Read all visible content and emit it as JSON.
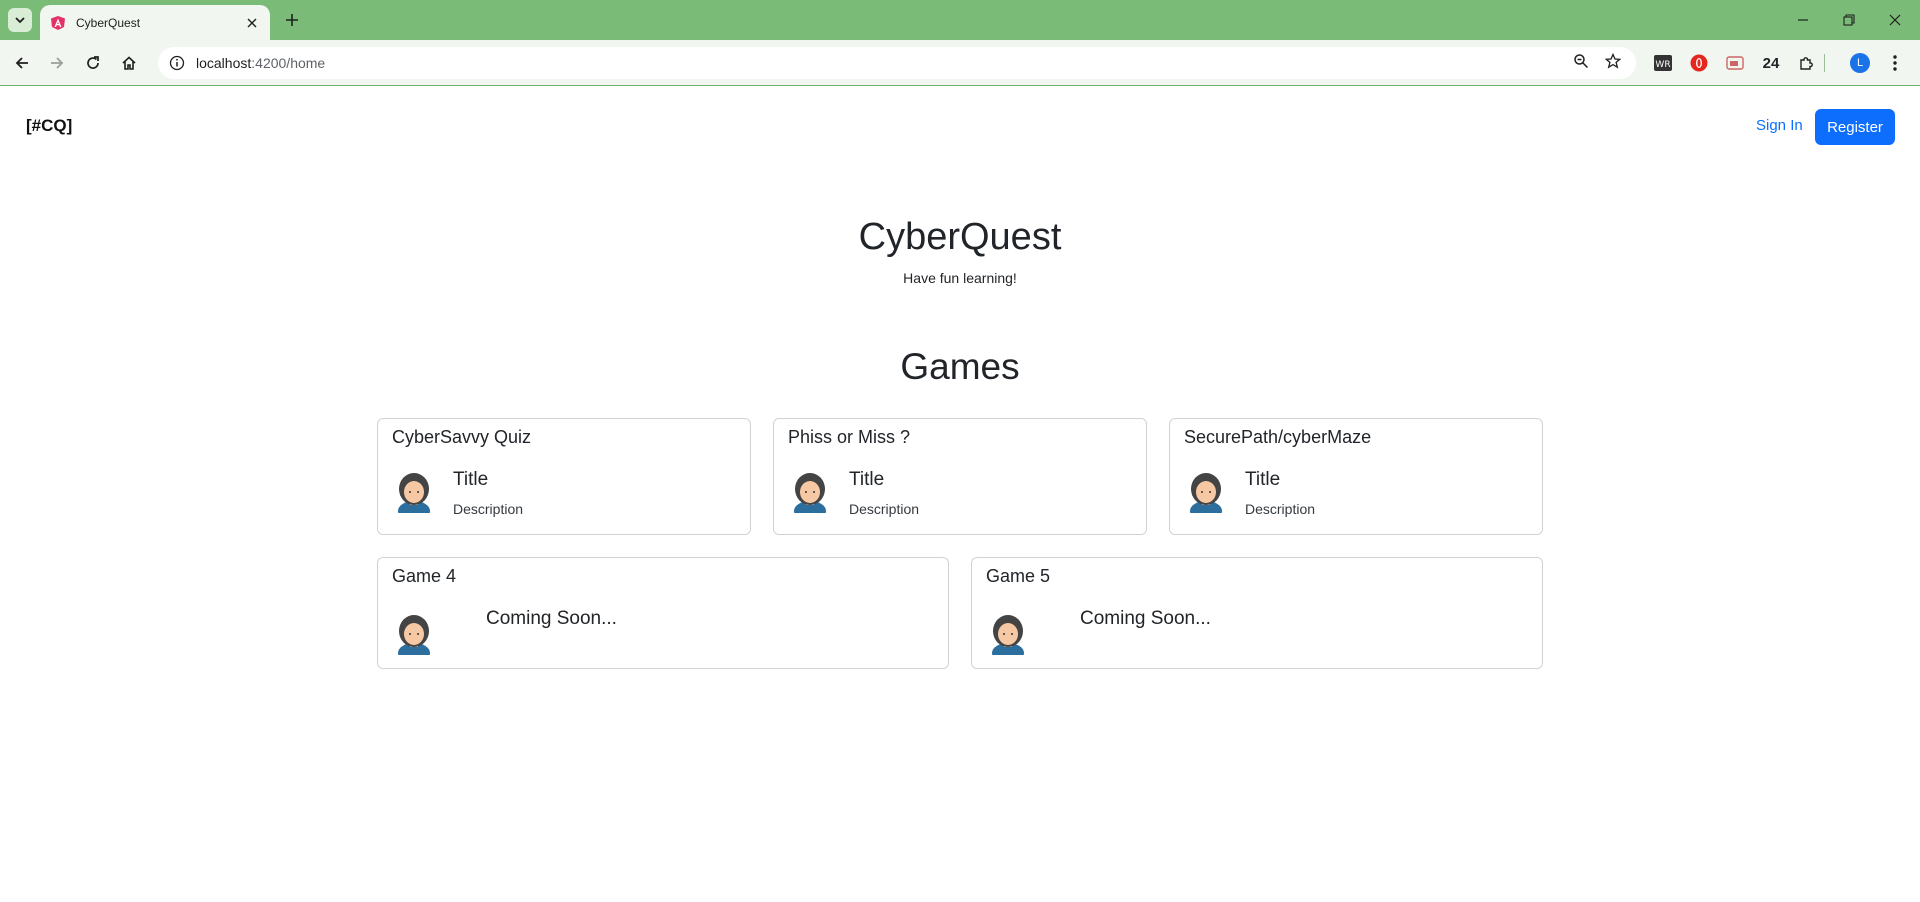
{
  "browser": {
    "tab_title": "CyberQuest",
    "url_host": "localhost",
    "url_path": ":4200/home",
    "extension_badge": "24",
    "profile_initial": "L"
  },
  "navbar": {
    "brand": "[#CQ]",
    "signin_label": "Sign In",
    "register_label": "Register"
  },
  "hero": {
    "title": "CyberQuest",
    "subtitle": "Have fun learning!"
  },
  "games": {
    "heading": "Games",
    "cards": [
      {
        "title": "CyberSavvy Quiz",
        "item_title": "Title",
        "item_desc": "Description"
      },
      {
        "title": "Phiss or Miss ?",
        "item_title": "Title",
        "item_desc": "Description"
      },
      {
        "title": "SecurePath/cyberMaze",
        "item_title": "Title",
        "item_desc": "Description"
      },
      {
        "title": "Game 4",
        "status": "Coming Soon..."
      },
      {
        "title": "Game 5",
        "status": "Coming Soon..."
      }
    ]
  },
  "colors": {
    "primary": "#0d6efd",
    "chrome_frame": "#7abb78",
    "toolbar": "#f1f6f0"
  }
}
